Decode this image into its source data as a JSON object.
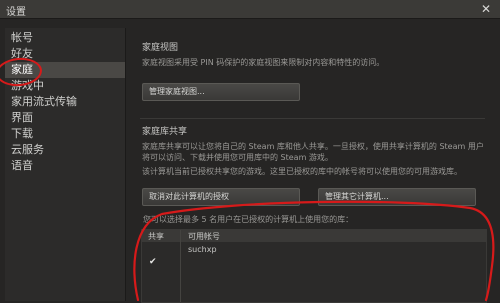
{
  "window": {
    "title": "设置",
    "close_glyph": "✕"
  },
  "sidebar": {
    "items": [
      {
        "label": "帐号"
      },
      {
        "label": "好友"
      },
      {
        "label": "家庭"
      },
      {
        "label": "游戏中"
      },
      {
        "label": "家用流式传输"
      },
      {
        "label": "界面"
      },
      {
        "label": "下载"
      },
      {
        "label": "云服务"
      },
      {
        "label": "语音"
      }
    ],
    "active_label": "家庭"
  },
  "family_view": {
    "title": "家庭视图",
    "description": "家庭视图采用受 PIN 码保护的家庭视图来限制对内容和特性的访问。",
    "button_label": "管理家庭视图..."
  },
  "library_sharing": {
    "title": "家庭库共享",
    "description_1": "家庭库共享可以让您将自己的 Steam 库和他人共享。一旦授权，使用共享计算机的 Steam 用户将可以访问、下载并使用您可用库中的 Steam 游戏。",
    "description_2": "该计算机当前已授权共享您的游戏。这里已授权的库中的帐号将可以使用您的可用游戏库。",
    "revoke_button_label": "取消对此计算机的授权",
    "manage_button_label": "管理其它计算机...",
    "eligible_label": "您可以选择最多 5 名用户在已授权的计算机上使用您的库：",
    "table": {
      "columns": [
        "共享",
        "可用帐号"
      ],
      "rows": [
        {
          "shared": true,
          "account": "suchxp"
        }
      ]
    }
  },
  "colors": {
    "background": "#262524",
    "sidebar": "#2c2b2a",
    "active_item": "#4a4845",
    "annotation": "#d61a1a"
  },
  "icons": {
    "checkbox": "check-icon",
    "close": "close-icon"
  }
}
